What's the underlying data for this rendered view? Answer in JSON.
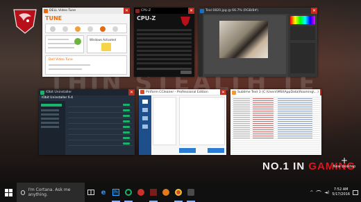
{
  "wallpaper": {
    "banner_text": "THIN STEALTH TECHNOLOGY",
    "slogan_part1": "NO.1 IN ",
    "slogan_part2": "GAMING"
  },
  "task_view": {
    "new_desktop_label": "New desktop",
    "windows": [
      {
        "id": "dell",
        "title": "DELL Video Tune",
        "icon": "dell-icon"
      },
      {
        "id": "cpuz",
        "title": "CPU-Z",
        "icon": "cpuz-icon"
      },
      {
        "id": "photoshop",
        "title": "Teal 0820.jpg @ 66.7% (RGB/8#)",
        "icon": "photoshop-icon"
      },
      {
        "id": "sfa",
        "title": "IObit Uninstaller",
        "icon": "iobit-icon"
      },
      {
        "id": "piriform",
        "title": "Piriform CCleaner - Professional Edition",
        "icon": "ccleaner-icon"
      },
      {
        "id": "sublime",
        "title": "Sublime Text 3 (C:\\Users\\MSI\\AppData\\Roaming\\...)",
        "icon": "sublime-icon"
      }
    ]
  },
  "dell_window": {
    "brand": "TUNE",
    "subtitle": "Dell Video Tune",
    "status": "Windows Activated"
  },
  "cpuz_window": {
    "brand": "CPU-Z"
  },
  "sfa_window": {
    "title": "IObit Uninstaller 6.4"
  },
  "taskbar": {
    "search_placeholder": "I'm Cortana. Ask me anything.",
    "time": "7:52 AM",
    "date": "5/17/2016"
  }
}
